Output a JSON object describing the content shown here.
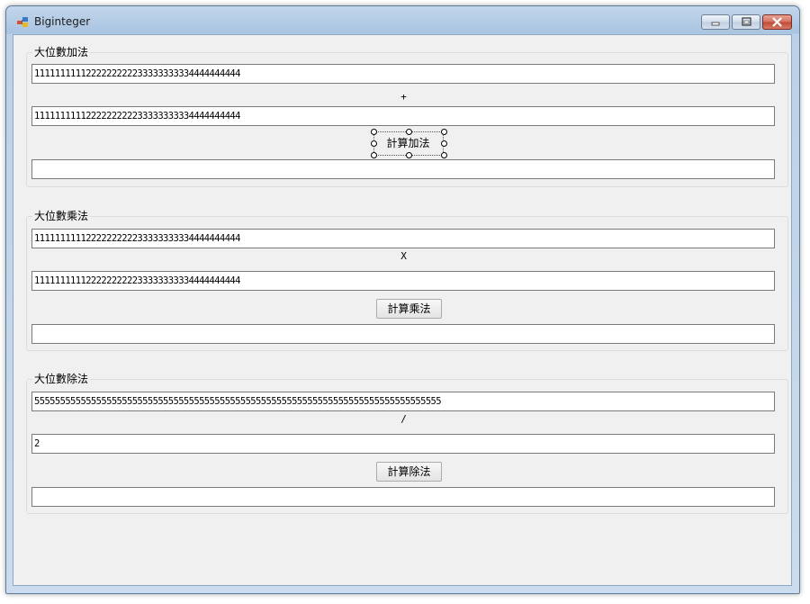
{
  "window": {
    "title": "Biginteger"
  },
  "addition": {
    "label": "大位數加法",
    "input_a": "1111111111222222222233333333334444444444",
    "operator": "+",
    "input_b": "1111111111222222222233333333334444444444",
    "button": "計算加法",
    "result": ""
  },
  "multiplication": {
    "label": "大位數乘法",
    "input_a": "1111111111222222222233333333334444444444",
    "operator": "X",
    "input_b": "1111111111222222222233333333334444444444",
    "button": "計算乘法",
    "result": ""
  },
  "division": {
    "label": "大位數除法",
    "input_a": "5555555555555555555555555555555555555555555555555555555555555555555555555555555",
    "operator": "/",
    "input_b": "2",
    "button": "計算除法",
    "result": ""
  },
  "colors": {
    "titlebar": "#a9c4e1",
    "client": "#f0f0f0",
    "close": "#c04a34"
  },
  "icons": [
    "app-icon",
    "minimize-icon",
    "restore-icon",
    "close-icon"
  ]
}
